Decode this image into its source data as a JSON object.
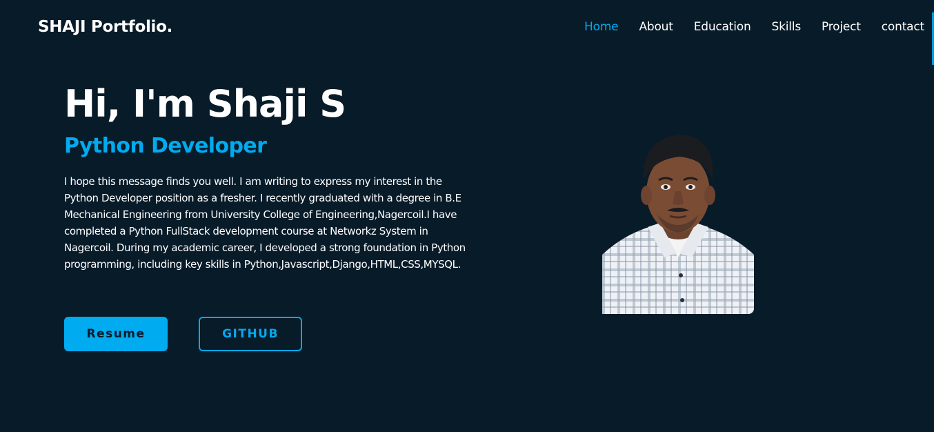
{
  "header": {
    "logo": "SHAJI Portfolio.",
    "nav": [
      {
        "label": "Home",
        "active": true
      },
      {
        "label": "About",
        "active": false
      },
      {
        "label": "Education",
        "active": false
      },
      {
        "label": "Skills",
        "active": false
      },
      {
        "label": "Project",
        "active": false
      },
      {
        "label": "contact",
        "active": false
      }
    ]
  },
  "hero": {
    "title": "Hi, I'm Shaji S",
    "subtitle": "Python Developer",
    "description": "I hope this message finds you well. I am writing to express my interest in the Python Developer position as a fresher. I recently graduated with a degree in B.E Mechanical Engineering from University College of Engineering,Nagercoil.I have completed a Python FullStack development course at Networkz System in Nagercoil. During my academic career, I developed a strong foundation in Python programming, including key skills in Python,Javascript,Django,HTML,CSS,MYSQL.",
    "buttons": {
      "resume": "Resume",
      "github": "GITHUB"
    }
  },
  "colors": {
    "background": "#081b29",
    "accent": "#00abf0",
    "text": "#ffffff"
  }
}
